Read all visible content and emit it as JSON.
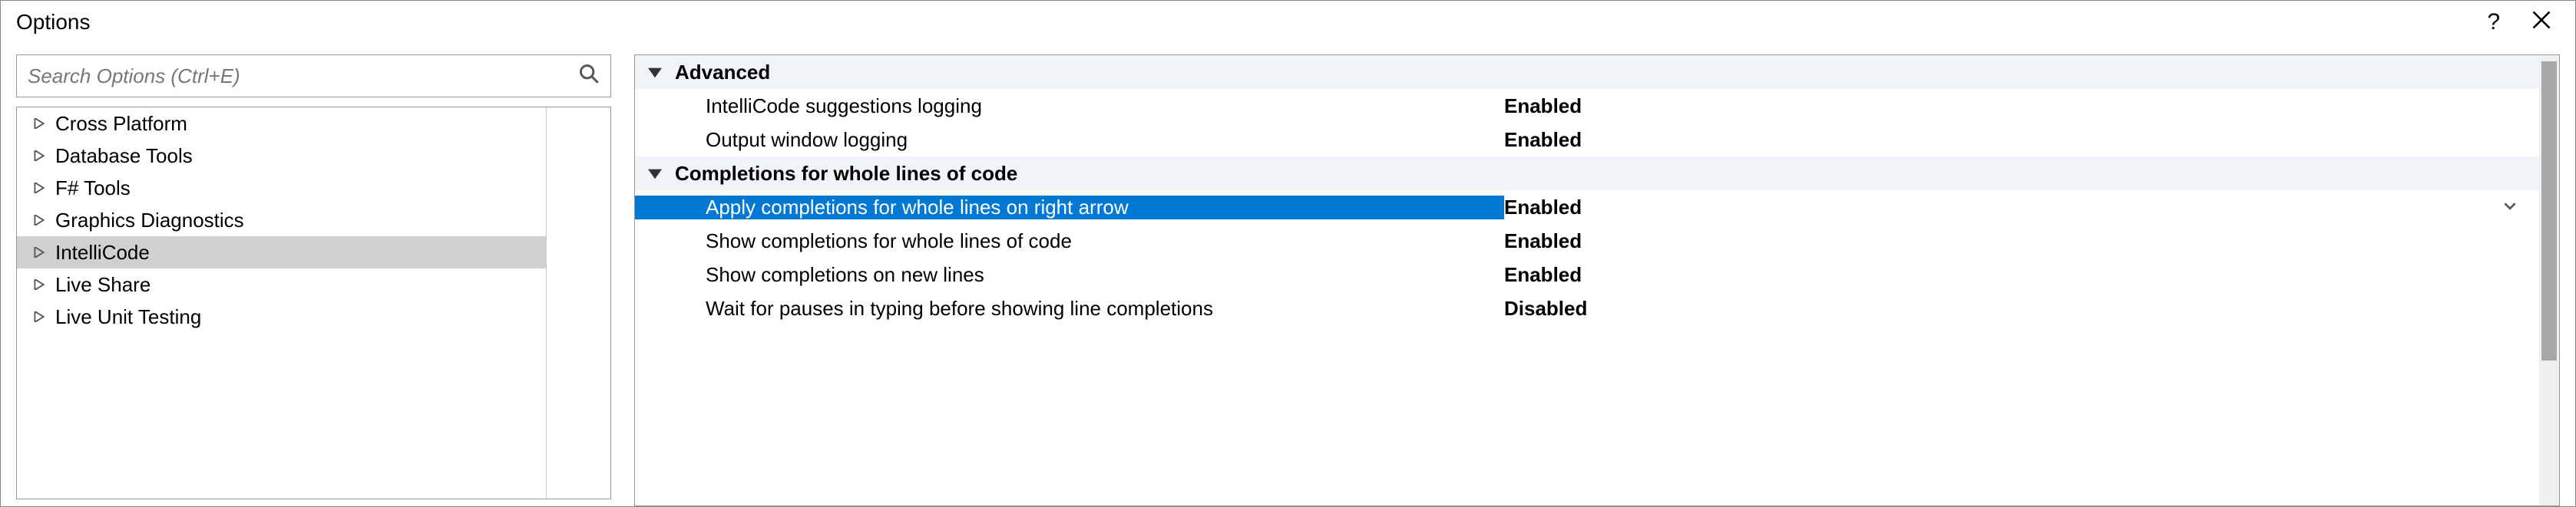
{
  "window": {
    "title": "Options",
    "help_tooltip": "?",
    "close_tooltip": "Close"
  },
  "search": {
    "placeholder": "Search Options (Ctrl+E)"
  },
  "tree": {
    "items": [
      {
        "label": "Cross Platform",
        "selected": false
      },
      {
        "label": "Database Tools",
        "selected": false
      },
      {
        "label": "F# Tools",
        "selected": false
      },
      {
        "label": "Graphics Diagnostics",
        "selected": false
      },
      {
        "label": "IntelliCode",
        "selected": true
      },
      {
        "label": "Live Share",
        "selected": false
      },
      {
        "label": "Live Unit Testing",
        "selected": false
      }
    ]
  },
  "grid": {
    "sections": [
      {
        "header": "Advanced",
        "rows": [
          {
            "label": "IntelliCode suggestions logging",
            "value": "Enabled",
            "selected": false
          },
          {
            "label": "Output window logging",
            "value": "Enabled",
            "selected": false
          }
        ]
      },
      {
        "header": "Completions for whole lines of code",
        "rows": [
          {
            "label": "Apply completions for whole lines on right arrow",
            "value": "Enabled",
            "selected": true
          },
          {
            "label": "Show completions for whole lines of code",
            "value": "Enabled",
            "selected": false
          },
          {
            "label": "Show completions on new lines",
            "value": "Enabled",
            "selected": false
          },
          {
            "label": "Wait for pauses in typing before showing line completions",
            "value": "Disabled",
            "selected": false
          }
        ]
      }
    ]
  }
}
